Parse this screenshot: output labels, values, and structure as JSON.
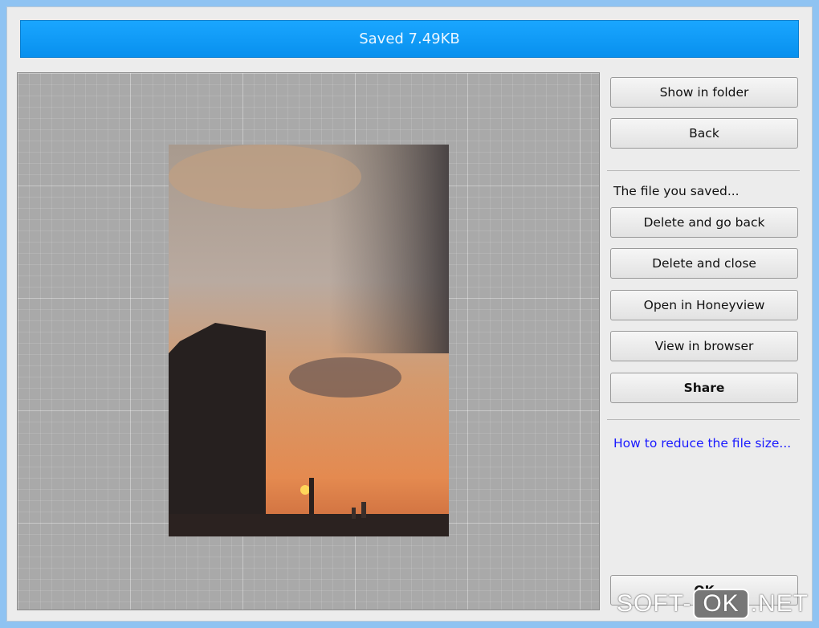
{
  "banner": {
    "title": "Saved 7.49KB",
    "color": "#0d99f8"
  },
  "side": {
    "show_in_folder": "Show in folder",
    "back": "Back",
    "section_label": "The file you saved...",
    "delete_go_back": "Delete and go back",
    "delete_close": "Delete and close",
    "open_honeyview": "Open in Honeyview",
    "view_browser": "View in browser",
    "share": "Share",
    "reduce_link": "How to reduce the file size...",
    "ok": "OK"
  },
  "watermark": {
    "text": "SOFT-OK.NET"
  }
}
